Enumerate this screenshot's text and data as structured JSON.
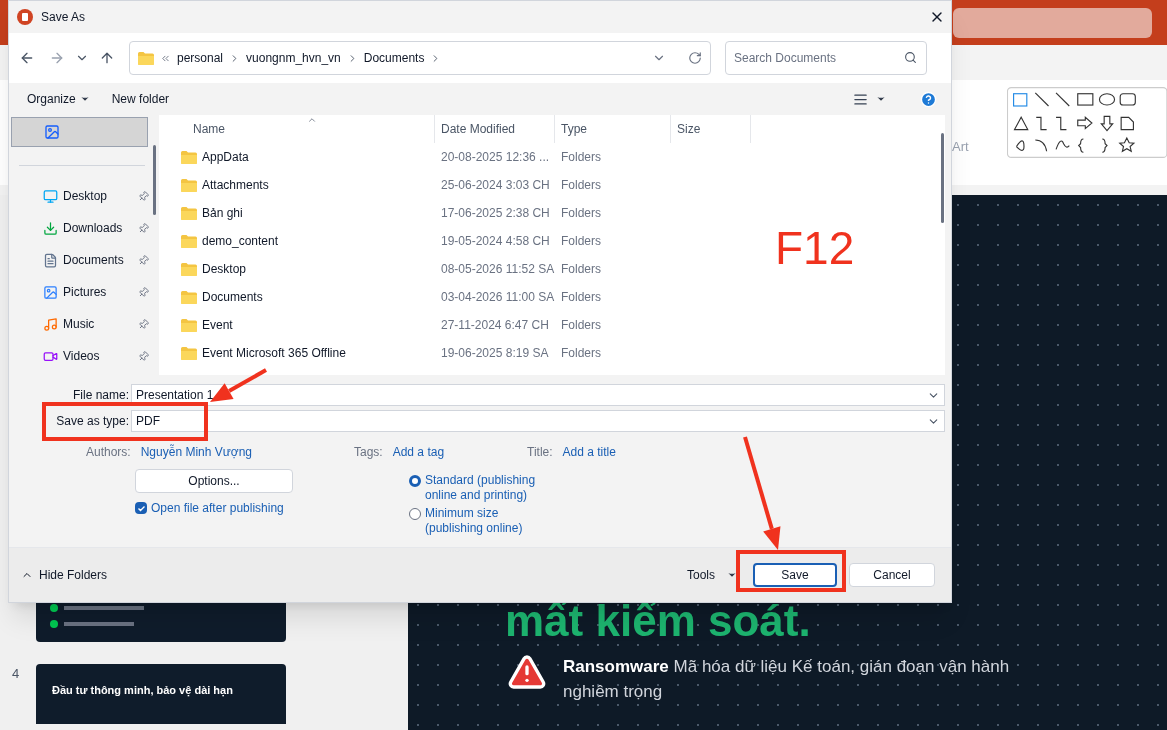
{
  "app": {
    "ribbon_label": "Art",
    "slide_pane": {
      "slide_number": "4",
      "thumb_title": "Đầu tư thông minh, bảo vệ dài hạn"
    },
    "slide": {
      "heading": "mất kiểm soát.",
      "risk": {
        "title": "Ransomware",
        "text": "Mã hóa dữ liệu Kế toán, gián đoạn vận hành nghiêm trọng"
      }
    }
  },
  "dialog": {
    "title": "Save As",
    "breadcrumb": [
      "personal",
      "vuongnm_hvn_vn",
      "Documents"
    ],
    "search": {
      "placeholder": "Search Documents"
    },
    "toolbar": {
      "organize": "Organize",
      "new_folder": "New folder"
    },
    "sidebar": {
      "top_item": {
        "selected": true
      },
      "items": [
        {
          "label": "Desktop",
          "kind": "desktop",
          "pinned": true
        },
        {
          "label": "Downloads",
          "kind": "downloads",
          "pinned": true
        },
        {
          "label": "Documents",
          "kind": "documents",
          "pinned": true
        },
        {
          "label": "Pictures",
          "kind": "pictures",
          "pinned": true
        },
        {
          "label": "Music",
          "kind": "music",
          "pinned": true
        },
        {
          "label": "Videos",
          "kind": "videos",
          "pinned": true
        }
      ]
    },
    "columns": [
      "Name",
      "Date Modified",
      "Type",
      "Size"
    ],
    "rows": [
      {
        "name": "AppData",
        "date": "20-08-2025 12:36 ...",
        "type": "Folders"
      },
      {
        "name": "Attachments",
        "date": "25-06-2024 3:03 CH",
        "type": "Folders"
      },
      {
        "name": "Bản ghi",
        "date": "17-06-2025 2:38 CH",
        "type": "Folders"
      },
      {
        "name": "demo_content",
        "date": "19-05-2024 4:58 CH",
        "type": "Folders"
      },
      {
        "name": "Desktop",
        "date": "08-05-2026 11:52 SA",
        "type": "Folders"
      },
      {
        "name": "Documents",
        "date": "03-04-2026 11:00 SA",
        "type": "Folders"
      },
      {
        "name": "Event",
        "date": "27-11-2024 6:47 CH",
        "type": "Folders"
      },
      {
        "name": "Event Microsoft 365 Offline",
        "date": "19-06-2025 8:19 SA",
        "type": "Folders"
      }
    ],
    "file_name": {
      "label": "File name:",
      "value": "Presentation 1"
    },
    "save_type": {
      "label": "Save as type:",
      "value": "PDF"
    },
    "meta": [
      {
        "label": "Authors:",
        "value": "Nguyễn Minh Vượng"
      },
      {
        "label": "Tags:",
        "value": "Add a tag"
      },
      {
        "label": "Title:",
        "value": "Add a title"
      }
    ],
    "options_button": "Options...",
    "open_after": {
      "label": "Open file after publishing",
      "checked": true
    },
    "optimize": [
      {
        "label": "Standard (publishing online and printing)",
        "selected": true
      },
      {
        "label": "Minimum size (publishing online)",
        "selected": false
      }
    ],
    "hide_folders": "Hide Folders",
    "tools": "Tools",
    "save": "Save",
    "cancel": "Cancel"
  },
  "annotation": {
    "label": "F12"
  }
}
